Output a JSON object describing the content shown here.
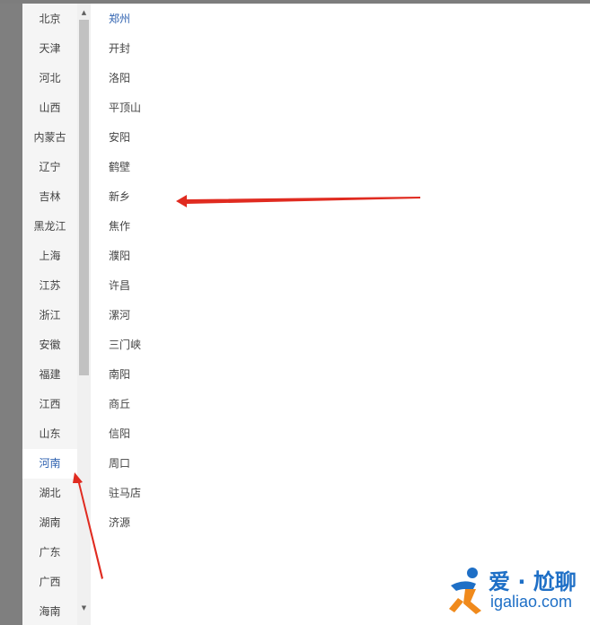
{
  "provinces": [
    {
      "label": "北京",
      "selected": false
    },
    {
      "label": "天津",
      "selected": false
    },
    {
      "label": "河北",
      "selected": false
    },
    {
      "label": "山西",
      "selected": false
    },
    {
      "label": "内蒙古",
      "selected": false
    },
    {
      "label": "辽宁",
      "selected": false
    },
    {
      "label": "吉林",
      "selected": false
    },
    {
      "label": "黑龙江",
      "selected": false
    },
    {
      "label": "上海",
      "selected": false
    },
    {
      "label": "江苏",
      "selected": false
    },
    {
      "label": "浙江",
      "selected": false
    },
    {
      "label": "安徽",
      "selected": false
    },
    {
      "label": "福建",
      "selected": false
    },
    {
      "label": "江西",
      "selected": false
    },
    {
      "label": "山东",
      "selected": false
    },
    {
      "label": "河南",
      "selected": true
    },
    {
      "label": "湖北",
      "selected": false
    },
    {
      "label": "湖南",
      "selected": false
    },
    {
      "label": "广东",
      "selected": false
    },
    {
      "label": "广西",
      "selected": false
    },
    {
      "label": "海南",
      "selected": false
    }
  ],
  "cities": [
    {
      "label": "郑州",
      "selected": true
    },
    {
      "label": "开封",
      "selected": false
    },
    {
      "label": "洛阳",
      "selected": false
    },
    {
      "label": "平顶山",
      "selected": false
    },
    {
      "label": "安阳",
      "selected": false
    },
    {
      "label": "鹤壁",
      "selected": false
    },
    {
      "label": "新乡",
      "selected": false
    },
    {
      "label": "焦作",
      "selected": false
    },
    {
      "label": "濮阳",
      "selected": false
    },
    {
      "label": "许昌",
      "selected": false
    },
    {
      "label": "漯河",
      "selected": false
    },
    {
      "label": "三门峡",
      "selected": false
    },
    {
      "label": "南阳",
      "selected": false
    },
    {
      "label": "商丘",
      "selected": false
    },
    {
      "label": "信阳",
      "selected": false
    },
    {
      "label": "周口",
      "selected": false
    },
    {
      "label": "驻马店",
      "selected": false
    },
    {
      "label": "济源",
      "selected": false
    }
  ],
  "scrollbar": {
    "up_icon": "▲",
    "down_icon": "▼",
    "scroll_position": 0.0
  },
  "watermark": {
    "text_cn": "爱 · 尬聊",
    "text_en": "igaliao.com"
  },
  "colors": {
    "selected_text": "#2f62b0",
    "normal_text": "#444444",
    "annotation_arrow": "#e02b20",
    "brand": "#1e6fc6"
  },
  "icons": {
    "scroll_up": "triangle-up-icon",
    "scroll_down": "triangle-down-icon",
    "annotation": "red-arrow-icon",
    "logo": "runner-logo-icon"
  }
}
